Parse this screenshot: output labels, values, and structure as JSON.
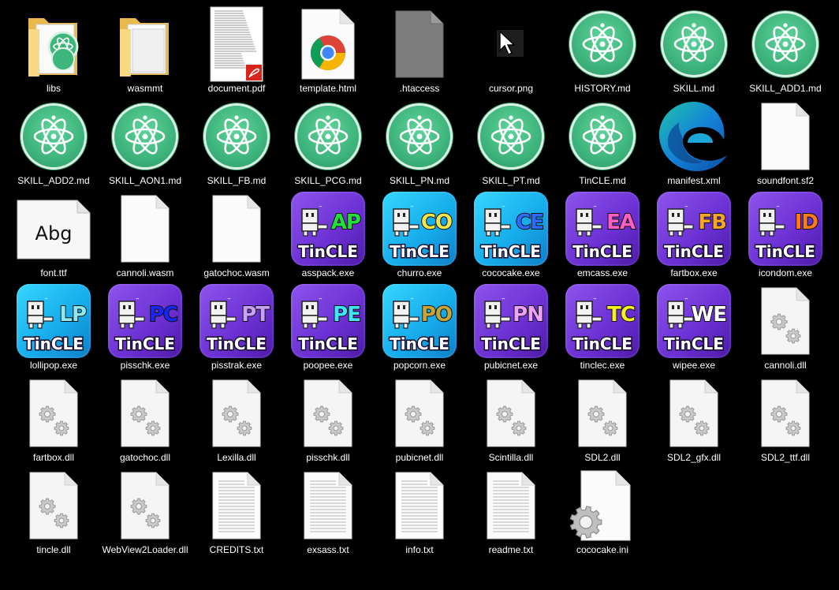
{
  "colors": {
    "desktop_bg": "#000000",
    "atom_green": "#3eb57c",
    "tile_purple": "#7b3fe0",
    "tile_cyan": "#1ec3f2"
  },
  "files": [
    {
      "label": "libs",
      "kind": "folder"
    },
    {
      "label": "wasmmt",
      "kind": "folder-plain"
    },
    {
      "label": "document.pdf",
      "kind": "pdf"
    },
    {
      "label": "template.html",
      "kind": "chrome"
    },
    {
      "label": ".htaccess",
      "kind": "generic-gray"
    },
    {
      "label": "cursor.png",
      "kind": "cursor"
    },
    {
      "label": "HISTORY.md",
      "kind": "atom"
    },
    {
      "label": "SKILL.md",
      "kind": "atom"
    },
    {
      "label": "SKILL_ADD1.md",
      "kind": "atom"
    },
    {
      "label": "SKILL_ADD2.md",
      "kind": "atom"
    },
    {
      "label": "SKILL_AON1.md",
      "kind": "atom"
    },
    {
      "label": "SKILL_FB.md",
      "kind": "atom"
    },
    {
      "label": "SKILL_PCG.md",
      "kind": "atom"
    },
    {
      "label": "SKILL_PN.md",
      "kind": "atom"
    },
    {
      "label": "SKILL_PT.md",
      "kind": "atom"
    },
    {
      "label": "TinCLE.md",
      "kind": "atom"
    },
    {
      "label": "manifest.xml",
      "kind": "edge"
    },
    {
      "label": "soundfont.sf2",
      "kind": "blank"
    },
    {
      "label": "font.ttf",
      "kind": "font",
      "sample": "Abg"
    },
    {
      "label": "cannoli.wasm",
      "kind": "blank"
    },
    {
      "label": "gatochoc.wasm",
      "kind": "blank"
    },
    {
      "label": "asspack.exe",
      "kind": "tincle",
      "code": "AP",
      "code_color": "#22e03a",
      "bg": "purple"
    },
    {
      "label": "churro.exe",
      "kind": "tincle",
      "code": "CO",
      "code_color": "#f2e64a",
      "bg": "cyan"
    },
    {
      "label": "cococake.exe",
      "kind": "tincle",
      "code": "CE",
      "code_color": "#2b6bff",
      "bg": "cyan"
    },
    {
      "label": "emcass.exe",
      "kind": "tincle",
      "code": "EA",
      "code_color": "#ff5fc0",
      "bg": "purple"
    },
    {
      "label": "fartbox.exe",
      "kind": "tincle",
      "code": "FB",
      "code_color": "#f4a62a",
      "bg": "purple"
    },
    {
      "label": "icondom.exe",
      "kind": "tincle",
      "code": "ID",
      "code_color": "#ff7a1a",
      "bg": "purple"
    },
    {
      "label": "lollipop.exe",
      "kind": "tincle",
      "code": "LP",
      "code_color": "#8fe7f0",
      "bg": "cyan"
    },
    {
      "label": "pisschk.exe",
      "kind": "tincle",
      "code": "PC",
      "code_color": "#1a24ff",
      "bg": "purple"
    },
    {
      "label": "pisstrak.exe",
      "kind": "tincle",
      "code": "PT",
      "code_color": "#c9a0ff",
      "bg": "purple"
    },
    {
      "label": "poopee.exe",
      "kind": "tincle",
      "code": "PE",
      "code_color": "#3de8ff",
      "bg": "purple"
    },
    {
      "label": "popcorn.exe",
      "kind": "tincle",
      "code": "PO",
      "code_color": "#c8a53a",
      "bg": "cyan"
    },
    {
      "label": "pubicnet.exe",
      "kind": "tincle",
      "code": "PN",
      "code_color": "#f0a0ff",
      "bg": "purple"
    },
    {
      "label": "tinclec.exe",
      "kind": "tincle",
      "code": "TC",
      "code_color": "#f7f01a",
      "bg": "purple"
    },
    {
      "label": "wipee.exe",
      "kind": "tincle",
      "code": "WE",
      "code_color": "#ffffff",
      "bg": "purple"
    },
    {
      "label": "cannoli.dll",
      "kind": "dll"
    },
    {
      "label": "fartbox.dll",
      "kind": "dll"
    },
    {
      "label": "gatochoc.dll",
      "kind": "dll"
    },
    {
      "label": "Lexilla.dll",
      "kind": "dll"
    },
    {
      "label": "pisschk.dll",
      "kind": "dll"
    },
    {
      "label": "pubicnet.dll",
      "kind": "dll"
    },
    {
      "label": "Scintilla.dll",
      "kind": "dll"
    },
    {
      "label": "SDL2.dll",
      "kind": "dll"
    },
    {
      "label": "SDL2_gfx.dll",
      "kind": "dll"
    },
    {
      "label": "SDL2_ttf.dll",
      "kind": "dll"
    },
    {
      "label": "tincle.dll",
      "kind": "dll"
    },
    {
      "label": "WebView2Loader.dll",
      "kind": "dll"
    },
    {
      "label": "CREDITS.txt",
      "kind": "txt"
    },
    {
      "label": "exsass.txt",
      "kind": "txt"
    },
    {
      "label": "info.txt",
      "kind": "txt"
    },
    {
      "label": "readme.txt",
      "kind": "txt"
    },
    {
      "label": "cococake.ini",
      "kind": "ini"
    }
  ],
  "tincle_word": "TinCLE"
}
